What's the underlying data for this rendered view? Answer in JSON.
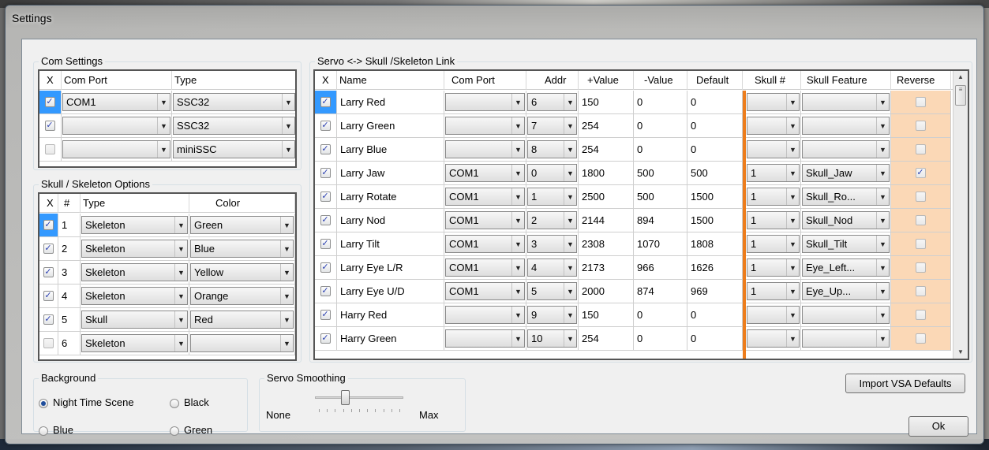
{
  "window": {
    "title": "Settings"
  },
  "com_settings": {
    "title": "Com Settings",
    "headers": [
      "X",
      "Com Port",
      "Type"
    ],
    "rows": [
      {
        "checked": true,
        "com_port": "COM1",
        "type": "SSC32",
        "selected": true
      },
      {
        "checked": true,
        "com_port": "",
        "type": "SSC32",
        "selected": false
      },
      {
        "checked": false,
        "com_port": "",
        "type": "miniSSC",
        "selected": false
      }
    ]
  },
  "skull_options": {
    "title": "Skull / Skeleton Options",
    "headers": [
      "X",
      "#",
      "Type",
      "Color"
    ],
    "rows": [
      {
        "checked": true,
        "num": "1",
        "type": "Skeleton",
        "color": "Green",
        "selected": true
      },
      {
        "checked": true,
        "num": "2",
        "type": "Skeleton",
        "color": "Blue",
        "selected": false
      },
      {
        "checked": true,
        "num": "3",
        "type": "Skeleton",
        "color": "Yellow",
        "selected": false
      },
      {
        "checked": true,
        "num": "4",
        "type": "Skeleton",
        "color": "Orange",
        "selected": false
      },
      {
        "checked": true,
        "num": "5",
        "type": "Skull",
        "color": "Red",
        "selected": false
      },
      {
        "checked": false,
        "num": "6",
        "type": "Skeleton",
        "color": "",
        "selected": false
      }
    ]
  },
  "servo_link": {
    "title": "Servo <-> Skull /Skeleton Link",
    "headers": [
      "X",
      "Name",
      "Com Port",
      "Addr",
      "+Value",
      "-Value",
      "Default",
      "Skull #",
      "Skull Feature",
      "Reverse"
    ],
    "rows": [
      {
        "checked": true,
        "name": "Larry Red",
        "com_port": "",
        "addr": "6",
        "plus": "150",
        "minus": "0",
        "default": "0",
        "skull": "",
        "feature": "",
        "reverse": false,
        "selected": true
      },
      {
        "checked": true,
        "name": "Larry Green",
        "com_port": "",
        "addr": "7",
        "plus": "254",
        "minus": "0",
        "default": "0",
        "skull": "",
        "feature": "",
        "reverse": false,
        "selected": false
      },
      {
        "checked": true,
        "name": "Larry Blue",
        "com_port": "",
        "addr": "8",
        "plus": "254",
        "minus": "0",
        "default": "0",
        "skull": "",
        "feature": "",
        "reverse": false,
        "selected": false
      },
      {
        "checked": true,
        "name": "Larry Jaw",
        "com_port": "COM1",
        "addr": "0",
        "plus": "1800",
        "minus": "500",
        "default": "500",
        "skull": "1",
        "feature": "Skull_Jaw",
        "reverse": true,
        "selected": false
      },
      {
        "checked": true,
        "name": "Larry Rotate",
        "com_port": "COM1",
        "addr": "1",
        "plus": "2500",
        "minus": "500",
        "default": "1500",
        "skull": "1",
        "feature": "Skull_Ro...",
        "reverse": false,
        "selected": false
      },
      {
        "checked": true,
        "name": "Larry Nod",
        "com_port": "COM1",
        "addr": "2",
        "plus": "2144",
        "minus": "894",
        "default": "1500",
        "skull": "1",
        "feature": "Skull_Nod",
        "reverse": false,
        "selected": false
      },
      {
        "checked": true,
        "name": "Larry Tilt",
        "com_port": "COM1",
        "addr": "3",
        "plus": "2308",
        "minus": "1070",
        "default": "1808",
        "skull": "1",
        "feature": "Skull_Tilt",
        "reverse": false,
        "selected": false
      },
      {
        "checked": true,
        "name": "Larry Eye L/R",
        "com_port": "COM1",
        "addr": "4",
        "plus": "2173",
        "minus": "966",
        "default": "1626",
        "skull": "1",
        "feature": "Eye_Left...",
        "reverse": false,
        "selected": false
      },
      {
        "checked": true,
        "name": "Larry Eye U/D",
        "com_port": "COM1",
        "addr": "5",
        "plus": "2000",
        "minus": "874",
        "default": "969",
        "skull": "1",
        "feature": "Eye_Up...",
        "reverse": false,
        "selected": false
      },
      {
        "checked": true,
        "name": "Harry Red",
        "com_port": "",
        "addr": "9",
        "plus": "150",
        "minus": "0",
        "default": "0",
        "skull": "",
        "feature": "",
        "reverse": false,
        "selected": false
      },
      {
        "checked": true,
        "name": "Harry Green",
        "com_port": "",
        "addr": "10",
        "plus": "254",
        "minus": "0",
        "default": "0",
        "skull": "",
        "feature": "",
        "reverse": false,
        "selected": false
      }
    ]
  },
  "background": {
    "title": "Background",
    "options": [
      {
        "label": "Night Time Scene",
        "selected": true
      },
      {
        "label": "Black",
        "selected": false
      },
      {
        "label": "Blue",
        "selected": false
      },
      {
        "label": "Green",
        "selected": false
      }
    ]
  },
  "servo_smoothing": {
    "title": "Servo Smoothing",
    "min_label": "None",
    "max_label": "Max",
    "level_fraction": 0.33
  },
  "buttons": {
    "import": "Import VSA Defaults",
    "ok": "Ok"
  },
  "colors": {
    "selection": "#3399ff",
    "separator": "#ed7d1c",
    "reverse_bg": "#fbd8b6"
  },
  "icons": {
    "checkbox": "checkmark-icon",
    "dropdown": "chevron-down-icon",
    "scroll_up": "scroll-up-icon",
    "scroll_down": "scroll-down-icon"
  }
}
